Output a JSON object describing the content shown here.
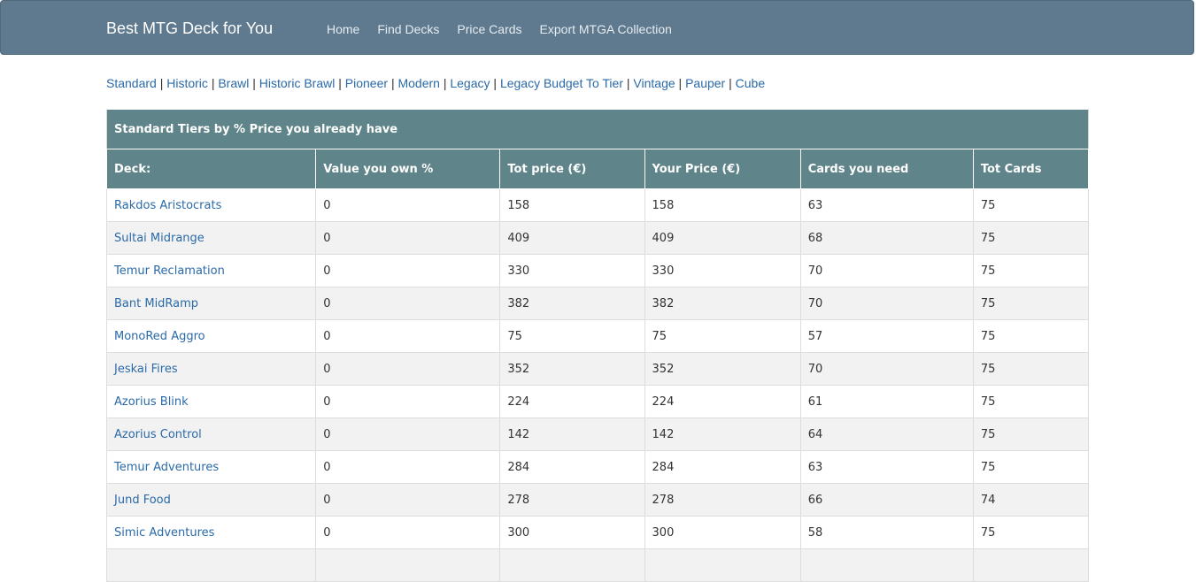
{
  "brand": "Best MTG Deck for You",
  "nav": [
    "Home",
    "Find Decks",
    "Price Cards",
    "Export MTGA Collection"
  ],
  "formats": [
    "Standard",
    "Historic",
    "Brawl",
    "Historic Brawl",
    "Pioneer",
    "Modern",
    "Legacy",
    "Legacy Budget To Tier",
    "Vintage",
    "Pauper",
    "Cube"
  ],
  "format_separator": "|",
  "table": {
    "caption": "Standard Tiers by % Price you already have",
    "headers": [
      "Deck:",
      "Value you own %",
      "Tot price (€)",
      "Your Price (€)",
      "Cards you need",
      "Tot Cards"
    ],
    "rows": [
      {
        "deck": "Rakdos Aristocrats",
        "own": "0",
        "tot_price": "158",
        "your_price": "158",
        "need": "63",
        "tot_cards": "75"
      },
      {
        "deck": "Sultai Midrange",
        "own": "0",
        "tot_price": "409",
        "your_price": "409",
        "need": "68",
        "tot_cards": "75"
      },
      {
        "deck": "Temur Reclamation",
        "own": "0",
        "tot_price": "330",
        "your_price": "330",
        "need": "70",
        "tot_cards": "75"
      },
      {
        "deck": "Bant MidRamp",
        "own": "0",
        "tot_price": "382",
        "your_price": "382",
        "need": "70",
        "tot_cards": "75"
      },
      {
        "deck": "MonoRed Aggro",
        "own": "0",
        "tot_price": "75",
        "your_price": "75",
        "need": "57",
        "tot_cards": "75"
      },
      {
        "deck": "Jeskai Fires",
        "own": "0",
        "tot_price": "352",
        "your_price": "352",
        "need": "70",
        "tot_cards": "75"
      },
      {
        "deck": "Azorius Blink",
        "own": "0",
        "tot_price": "224",
        "your_price": "224",
        "need": "61",
        "tot_cards": "75"
      },
      {
        "deck": "Azorius Control",
        "own": "0",
        "tot_price": "142",
        "your_price": "142",
        "need": "64",
        "tot_cards": "75"
      },
      {
        "deck": "Temur Adventures",
        "own": "0",
        "tot_price": "284",
        "your_price": "284",
        "need": "63",
        "tot_cards": "75"
      },
      {
        "deck": "Jund Food",
        "own": "0",
        "tot_price": "278",
        "your_price": "278",
        "need": "66",
        "tot_cards": "74"
      },
      {
        "deck": "Simic Adventures",
        "own": "0",
        "tot_price": "300",
        "your_price": "300",
        "need": "58",
        "tot_cards": "75"
      },
      {
        "deck": "",
        "own": "",
        "tot_price": "",
        "your_price": "",
        "need": "",
        "tot_cards": ""
      }
    ]
  },
  "colors": {
    "navbar": "#5f7a8f",
    "table_header": "#5f8489",
    "link": "#2a6aa8",
    "row_stripe": "#f2f2f2"
  }
}
